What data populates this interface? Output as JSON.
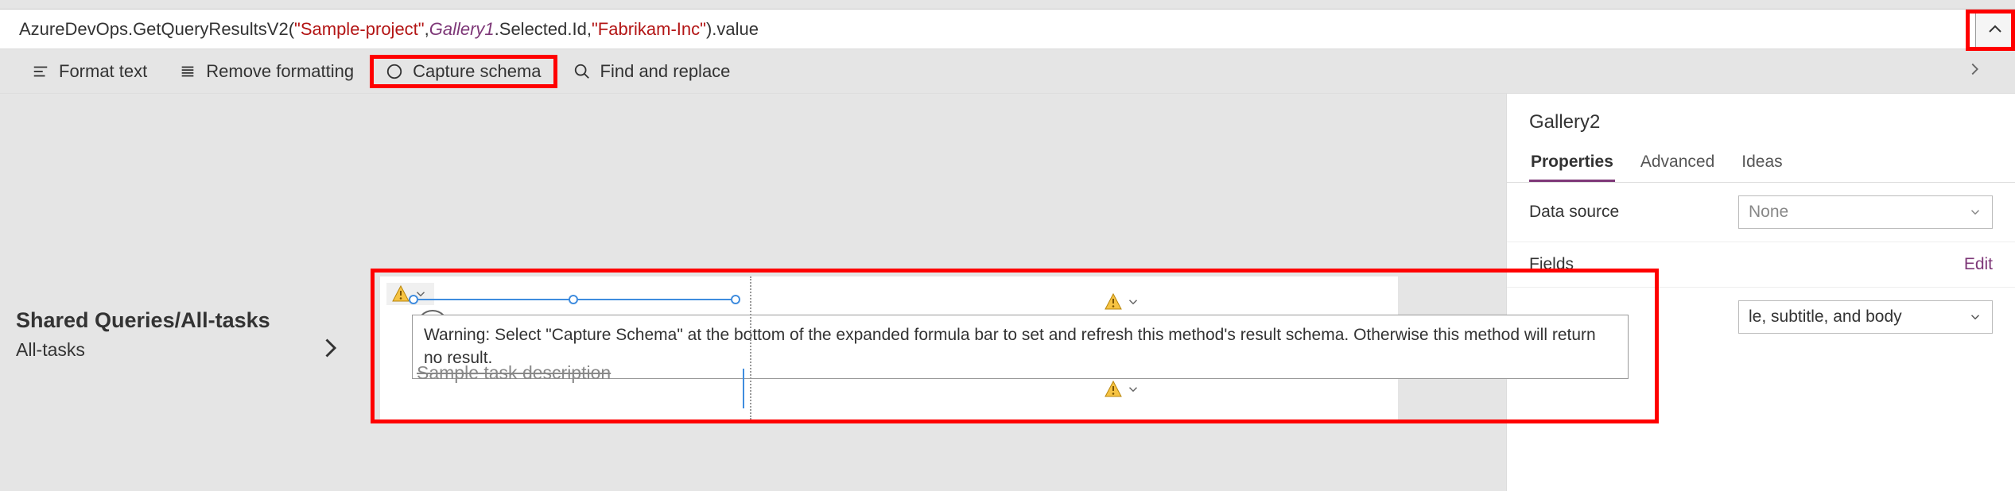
{
  "formula": {
    "prefix": "AzureDevOps.",
    "method": "GetQueryResultsV2",
    "arg1": "\"Sample-project\"",
    "ident": "Gallery1",
    "chain": ".Selected.Id,",
    "arg3": "\"Fabrikam-Inc\"",
    "suffix": ").value"
  },
  "toolbar": {
    "format": "Format text",
    "remove": "Remove formatting",
    "capture": "Capture schema",
    "find": "Find and replace"
  },
  "leftPanel": {
    "title": "Shared Queries/All-tasks",
    "subtitle": "All-tasks"
  },
  "gallery": {
    "strikeText": "Sample task description"
  },
  "tooltip": {
    "text": "Warning: Select \"Capture Schema\" at the bottom of the expanded formula bar to set and refresh this method's result schema. Otherwise this method will return no result."
  },
  "pane": {
    "title": "Gallery2",
    "tabs": {
      "properties": "Properties",
      "advanced": "Advanced",
      "ideas": "Ideas"
    },
    "dataSourceLabel": "Data source",
    "dataSourceValue": "None",
    "fieldsLabel": "Fields",
    "editLabel": "Edit",
    "layoutValue": "le, subtitle, and body"
  }
}
